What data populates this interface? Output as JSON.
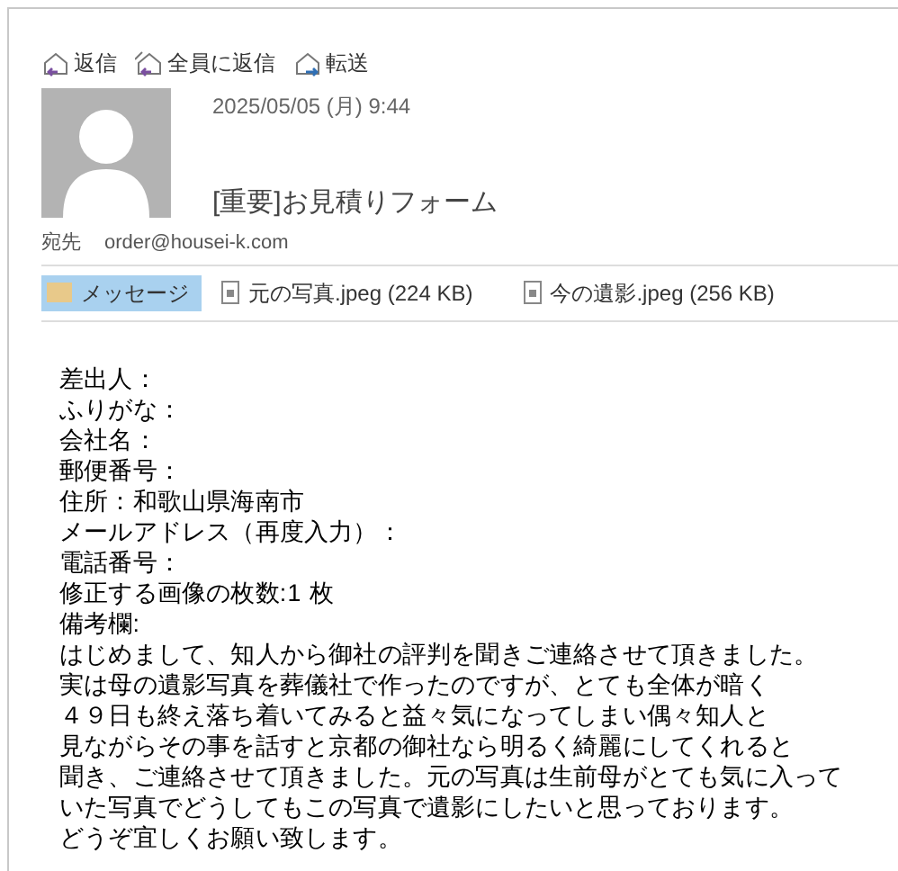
{
  "actions": [
    {
      "label": "返信",
      "kind": "reply"
    },
    {
      "label": "全員に返信",
      "kind": "reply_all"
    },
    {
      "label": "転送",
      "kind": "forward"
    }
  ],
  "header": {
    "date": "2025/05/05 (月) 9:44",
    "subject": "[重要]お見積りフォーム",
    "to_label": "宛先",
    "to": "order@housei-k.com"
  },
  "attachments": [
    {
      "label": "メッセージ",
      "kind": "message",
      "selected": true
    },
    {
      "label": "元の写真.jpeg (224 KB)",
      "kind": "file",
      "selected": false
    },
    {
      "label": "今の遺影.jpeg (256 KB)",
      "kind": "file",
      "selected": false
    }
  ],
  "body": [
    "差出人：",
    "ふりがな：",
    "会社名：",
    "郵便番号：",
    "住所：和歌山県海南市",
    "メールアドレス（再度入力）：",
    "電話番号：",
    "修正する画像の枚数:1 枚",
    "備考欄:",
    "はじめまして、知人から御社の評判を聞きご連絡させて頂きました。",
    "実は母の遺影写真を葬儀社で作ったのですが、とても全体が暗く",
    "４９日も終え落ち着いてみると益々気になってしまい偶々知人と",
    "見ながらその事を話すと京都の御社なら明るく綺麗にしてくれると",
    "聞き、ご連絡させて頂きました。元の写真は生前母がとても気に入って",
    "いた写真でどうしてもこの写真で遺影にしたいと思っております。",
    "どうぞ宜しくお願い致します。"
  ]
}
